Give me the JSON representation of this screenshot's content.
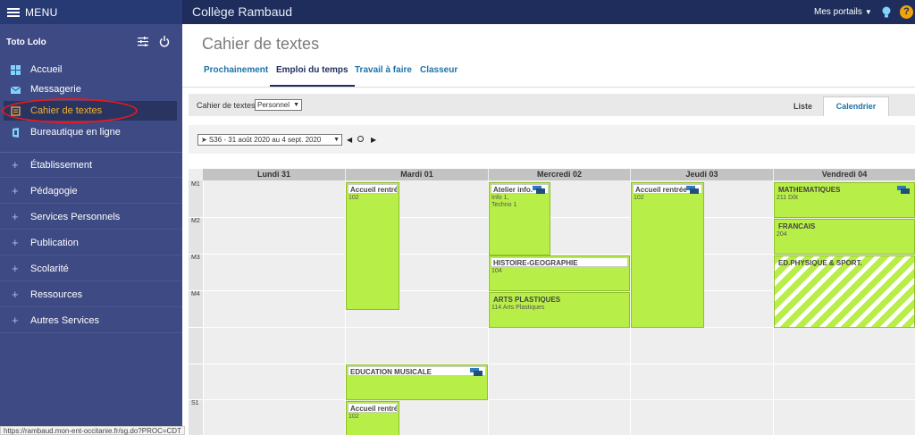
{
  "topbar": {
    "menu_label": "MENU",
    "school": "Collège Rambaud",
    "portals_label": "Mes portails",
    "help_label": "?"
  },
  "sidebar": {
    "user": "Toto Lolo",
    "items": [
      {
        "label": "Accueil",
        "icon": "grid-icon"
      },
      {
        "label": "Messagerie",
        "icon": "envelope-icon"
      },
      {
        "label": "Cahier de textes",
        "icon": "notebook-icon",
        "active": true
      },
      {
        "label": "Bureautique en ligne",
        "icon": "office-icon"
      }
    ],
    "groups": [
      "Établissement",
      "Pédagogie",
      "Services Personnels",
      "Publication",
      "Scolarité",
      "Ressources",
      "Autres Services"
    ]
  },
  "main": {
    "title": "Cahier de textes",
    "tabs": [
      "Prochainement",
      "Emploi du temps",
      "Travail à faire",
      "Classeur"
    ],
    "active_tab": "Emploi du temps",
    "filter_label": "Cahier de textes",
    "filter_value": "Personnel",
    "view_list": "Liste",
    "view_calendar": "Calendrier",
    "week_value": "➤ S36 - 31 août 2020 au 4 sept. 2020"
  },
  "calendar": {
    "days": [
      "Lundi 31",
      "Mardi 01",
      "Mercredi 02",
      "Jeudi 03",
      "Vendredi 04"
    ],
    "slots": [
      "M1",
      "M2",
      "M3",
      "M4",
      "S1"
    ],
    "events": [
      {
        "title": "Accueil rentrée",
        "room": "102"
      },
      {
        "title": "EDUCATION MUSICALE",
        "room": ""
      },
      {
        "title": "Accueil rentrée",
        "room": "102"
      },
      {
        "title": "Atelier info.",
        "room": "Info 1,",
        "room2": "Techno 1"
      },
      {
        "title": "HISTOIRE-GEOGRAPHIE",
        "room": "104"
      },
      {
        "title": "ARTS PLASTIQUES",
        "room": "114 Arts Plastiques"
      },
      {
        "title": "Accueil rentrée",
        "room": "102"
      },
      {
        "title": "MATHEMATIQUES",
        "room": "211 Dôt"
      },
      {
        "title": "FRANCAIS",
        "room": "204"
      },
      {
        "title": "ED.PHYSIQUE & SPORT.",
        "room": ""
      }
    ]
  },
  "statusbar": {
    "url": "https://rambaud.mon-ent-occitanie.fr/sg.do?PROC=CDT"
  },
  "colors": {
    "topbar": "#1f2d5c",
    "sidebar": "#3e4a84",
    "event": "#b8ee48",
    "active_menu": "#f6b02c",
    "link": "#1d72a8"
  }
}
